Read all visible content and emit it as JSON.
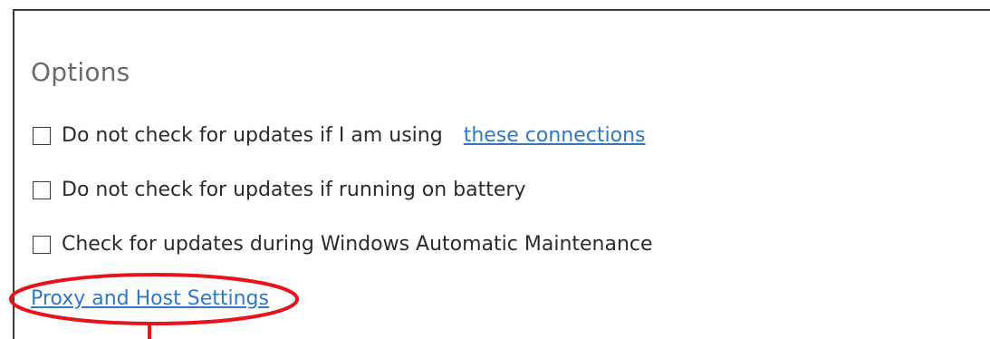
{
  "options": {
    "title": "Options",
    "items": [
      {
        "label": "Do not check for updates if I am using",
        "checked": false,
        "link": "these connections"
      },
      {
        "label": "Do not check for updates if running on battery",
        "checked": false
      },
      {
        "label": "Check for updates during Windows Automatic Maintenance",
        "checked": false
      }
    ],
    "proxy_link": "Proxy and Host Settings"
  },
  "colors": {
    "link": "#2e78c4",
    "annotation": "#e8141c",
    "title": "#6a6a6a",
    "text": "#2b2b2b"
  }
}
